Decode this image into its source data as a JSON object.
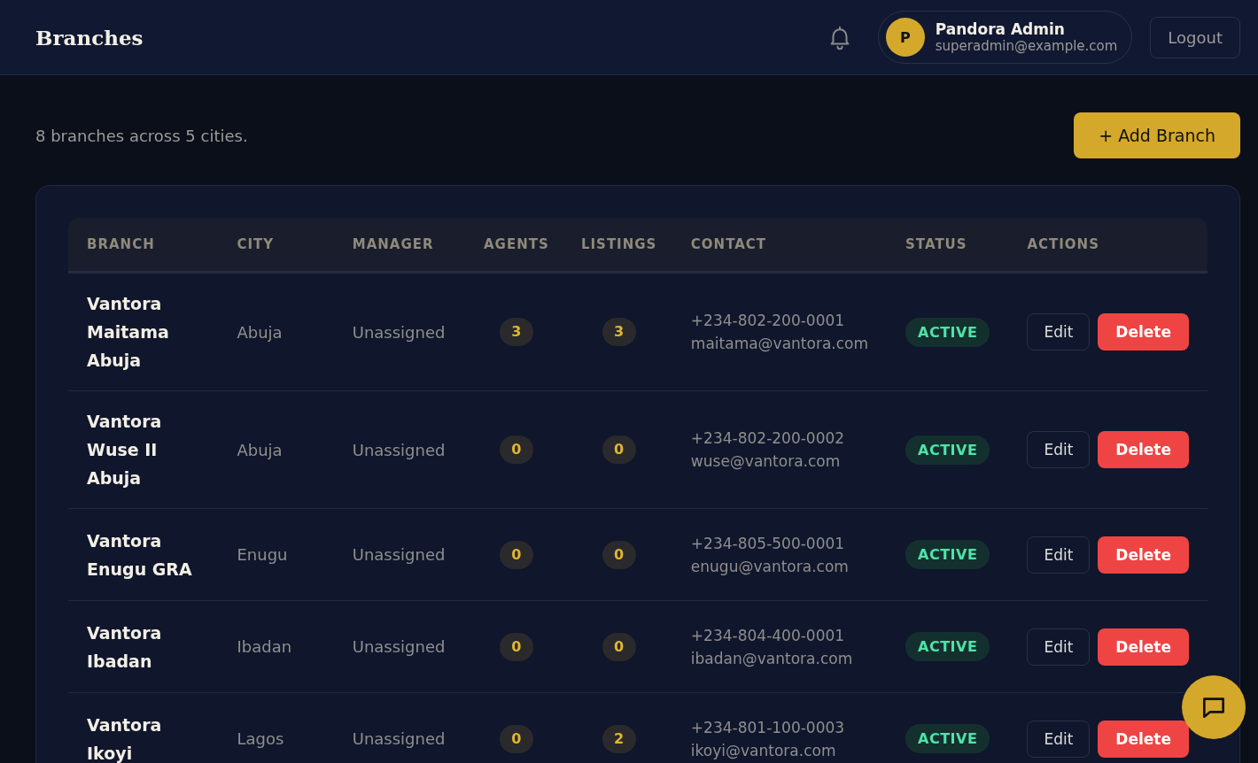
{
  "header": {
    "title": "Branches",
    "user": {
      "initial": "P",
      "name": "Pandora Admin",
      "email": "superadmin@example.com"
    },
    "logout": "Logout"
  },
  "summary": "8 branches across 5 cities.",
  "add_button": "+ Add Branch",
  "table": {
    "columns": [
      "BRANCH",
      "CITY",
      "MANAGER",
      "AGENTS",
      "LISTINGS",
      "CONTACT",
      "STATUS",
      "ACTIONS"
    ],
    "rows": [
      {
        "branch": "Vantora Maitama Abuja",
        "city": "Abuja",
        "manager": "Unassigned",
        "agents": "3",
        "listings": "3",
        "phone": "+234-802-200-0001",
        "email": "maitama@vantora.com",
        "status": "ACTIVE",
        "edit": "Edit",
        "delete": "Delete"
      },
      {
        "branch": "Vantora Wuse II Abuja",
        "city": "Abuja",
        "manager": "Unassigned",
        "agents": "0",
        "listings": "0",
        "phone": "+234-802-200-0002",
        "email": "wuse@vantora.com",
        "status": "ACTIVE",
        "edit": "Edit",
        "delete": "Delete"
      },
      {
        "branch": "Vantora Enugu GRA",
        "city": "Enugu",
        "manager": "Unassigned",
        "agents": "0",
        "listings": "0",
        "phone": "+234-805-500-0001",
        "email": "enugu@vantora.com",
        "status": "ACTIVE",
        "edit": "Edit",
        "delete": "Delete"
      },
      {
        "branch": "Vantora Ibadan",
        "city": "Ibadan",
        "manager": "Unassigned",
        "agents": "0",
        "listings": "0",
        "phone": "+234-804-400-0001",
        "email": "ibadan@vantora.com",
        "status": "ACTIVE",
        "edit": "Edit",
        "delete": "Delete"
      },
      {
        "branch": "Vantora Ikoyi",
        "city": "Lagos",
        "manager": "Unassigned",
        "agents": "0",
        "listings": "2",
        "phone": "+234-801-100-0003",
        "email": "ikoyi@vantora.com",
        "status": "ACTIVE",
        "edit": "Edit",
        "delete": "Delete"
      }
    ]
  }
}
